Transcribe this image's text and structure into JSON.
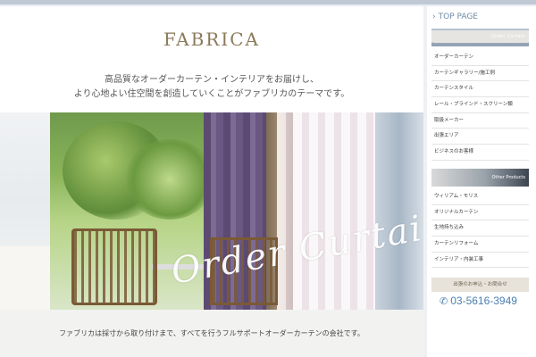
{
  "brand": {
    "logo_text": "FABRICA"
  },
  "main": {
    "tagline_line1": "高品質なオーダーカーテン・インテリアをお届けし、",
    "tagline_line2": "より心地よい住空間を創造していくことがファブリカのテーマです。",
    "hero_script": "Order Curtain",
    "bottom_text": "ファブリカは採寸から取り付けまで、すべてを行うフルサポートオーダーカーテンの会社です。"
  },
  "sidebar": {
    "top_page": "TOP PAGE",
    "banner1_label": "Order Curtain",
    "menu1": [
      "オーダーカーテン",
      "カーテンギャラリー/施工例",
      "カーテンスタイル",
      "レール・ブラインド・スクリーン類",
      "取扱メーカー",
      "出張エリア",
      "ビジネスのお客様"
    ],
    "banner2_label": "Other Products",
    "menu2": [
      "ウィリアム・モリス",
      "オリジナルカーテン",
      "生地持ち込み",
      "カーテンリフォーム",
      "インテリア・内装工事"
    ],
    "contact_label": "出張のお申込・お問合せ",
    "phone": "03-5616-3949"
  },
  "icons": {
    "top_page_chevron": "chevron-right-icon",
    "phone": "phone-icon"
  },
  "colors": {
    "accent_blue": "#4a7fb0",
    "logo_gold": "#8a7a5a"
  }
}
